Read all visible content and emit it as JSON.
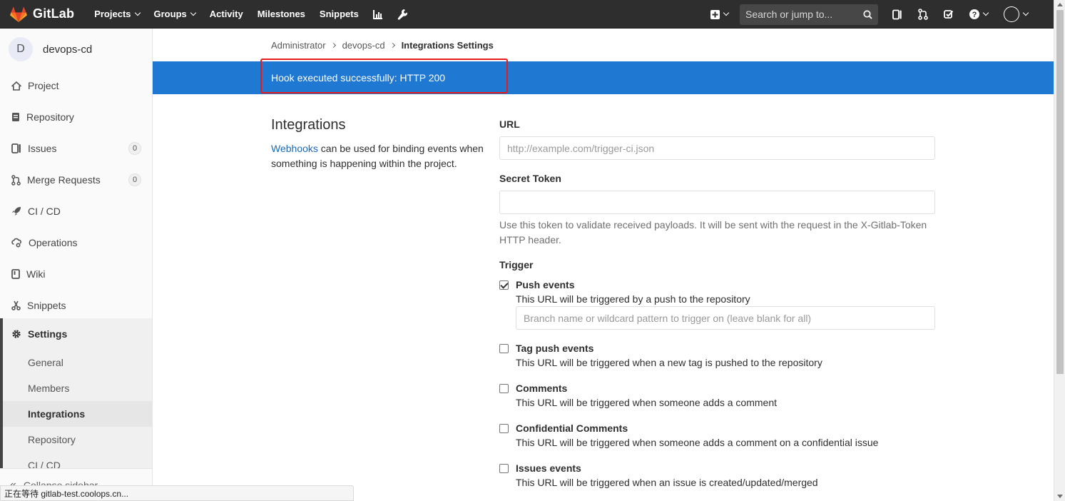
{
  "navbar": {
    "brand": "GitLab",
    "links": [
      {
        "label": "Projects",
        "caret": true
      },
      {
        "label": "Groups",
        "caret": true
      },
      {
        "label": "Activity",
        "caret": false
      },
      {
        "label": "Milestones",
        "caret": false
      },
      {
        "label": "Snippets",
        "caret": false
      }
    ],
    "search_placeholder": "Search or jump to..."
  },
  "sidebar": {
    "project_initial": "D",
    "project_name": "devops-cd",
    "items": [
      {
        "label": "Project"
      },
      {
        "label": "Repository"
      },
      {
        "label": "Issues",
        "count": "0"
      },
      {
        "label": "Merge Requests",
        "count": "0"
      },
      {
        "label": "CI / CD"
      },
      {
        "label": "Operations"
      },
      {
        "label": "Wiki"
      },
      {
        "label": "Snippets"
      },
      {
        "label": "Settings"
      }
    ],
    "settings_sub": [
      "General",
      "Members",
      "Integrations",
      "Repository",
      "CI / CD"
    ],
    "collapse_label": "Collapse sidebar"
  },
  "breadcrumb": [
    "Administrator",
    "devops-cd",
    "Integrations Settings"
  ],
  "flash": "Hook executed successfully: HTTP 200",
  "intro": {
    "title": "Integrations",
    "link": "Webhooks",
    "text": " can be used for binding events when something is happening within the project."
  },
  "form": {
    "url_label": "URL",
    "url_placeholder": "http://example.com/trigger-ci.json",
    "token_label": "Secret Token",
    "token_help": "Use this token to validate received payloads. It will be sent with the request in the X-Gitlab-Token HTTP header.",
    "trigger_label": "Trigger",
    "branch_placeholder": "Branch name or wildcard pattern to trigger on (leave blank for all)",
    "triggers": [
      {
        "title": "Push events",
        "desc": "This URL will be triggered by a push to the repository",
        "checked": true
      },
      {
        "title": "Tag push events",
        "desc": "This URL will be triggered when a new tag is pushed to the repository",
        "checked": false
      },
      {
        "title": "Comments",
        "desc": "This URL will be triggered when someone adds a comment",
        "checked": false
      },
      {
        "title": "Confidential Comments",
        "desc": "This URL will be triggered when someone adds a comment on a confidential issue",
        "checked": false
      },
      {
        "title": "Issues events",
        "desc": "This URL will be triggered when an issue is created/updated/merged",
        "checked": false
      }
    ]
  },
  "statusbar": "正在等待 gitlab-test.coolops.cn...",
  "colors": {
    "navbar": "#2e2e2e",
    "flash": "#1f78d1",
    "link": "#1b69b6",
    "highlight": "#e81b1b"
  }
}
